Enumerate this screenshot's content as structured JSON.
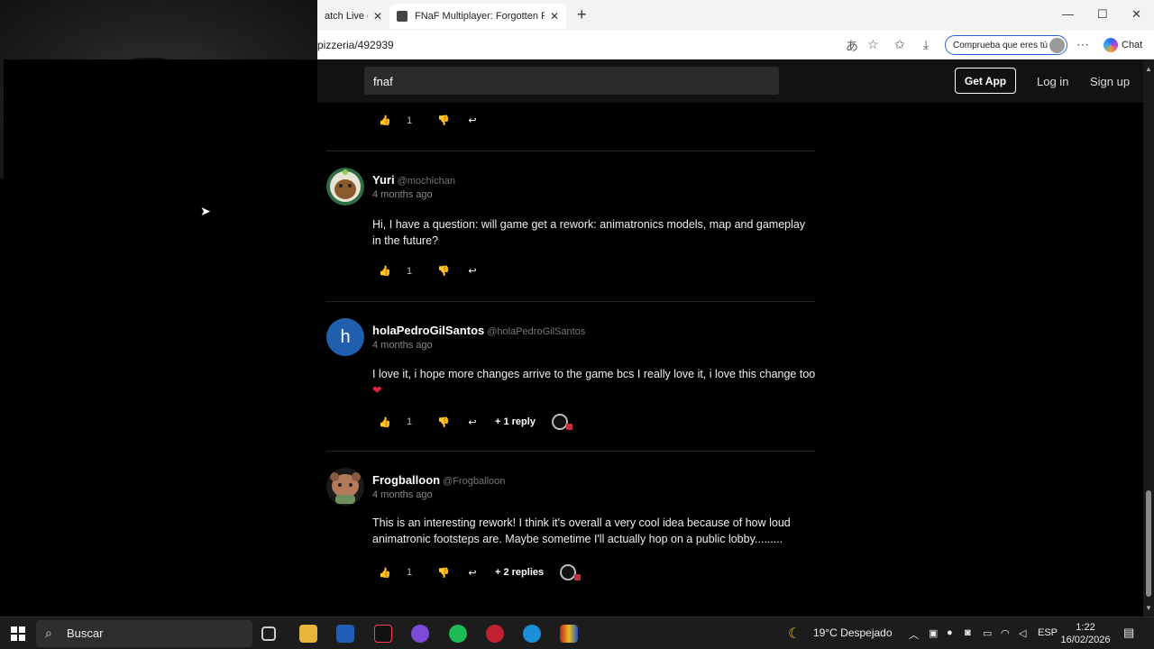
{
  "browser": {
    "tabs": [
      {
        "label": "atch Live on K",
        "active": false
      },
      {
        "label": "FNaF Multiplayer: Forgotten Pizzeria",
        "active": true
      }
    ],
    "url": "pizzeria/492939",
    "profile_pill": "Comprueba que eres tú",
    "chat_label": "Chat"
  },
  "site": {
    "search_value": "fnaf",
    "get_app": "Get App",
    "login": "Log in",
    "signup": "Sign up"
  },
  "top_actions": {
    "likes": "1"
  },
  "comments": [
    {
      "name": "Yuri",
      "handle": "@mochichan",
      "time": "4 months ago",
      "text": "Hi, I have a question: will game get a rework: animatronics models, map and gameplay in the future?",
      "likes": "1",
      "replies": ""
    },
    {
      "name": "holaPedroGilSantos",
      "handle": "@holaPedroGilSantos",
      "avatar_letter": "h",
      "time": "4 months ago",
      "text": "I love it, i hope more changes arrive to the game bcs I really love it, i love this change too",
      "likes": "1",
      "replies": "+ 1 reply"
    },
    {
      "name": "Frogballoon",
      "handle": "@Frogballoon",
      "time": "4 months ago",
      "text": "This is an interesting rework! I think it's overall a very cool idea because of how loud animatronic footsteps are. Maybe sometime I'll actually hop on a public lobby.........",
      "likes": "1",
      "replies": "+ 2 replies"
    }
  ],
  "taskbar": {
    "search_placeholder": "Buscar",
    "weather": "19°C  Despejado",
    "lang": "ESP",
    "time": "1:22",
    "date": "16/02/2026"
  },
  "colors": {
    "page_bg": "#000000",
    "header_bg": "#121212",
    "avatar_blue": "#1f5fae",
    "heart_red": "#e0283c"
  }
}
